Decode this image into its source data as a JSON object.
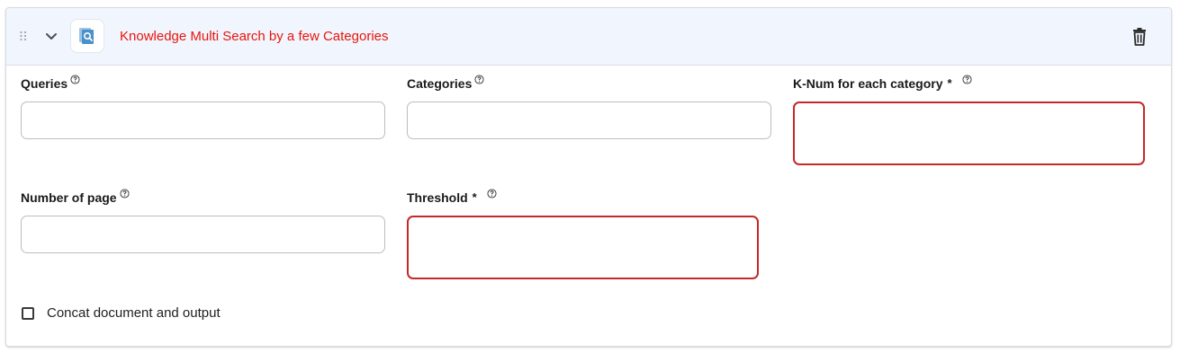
{
  "header": {
    "title": "Knowledge Multi Search by a few Categories",
    "icons": {
      "drag": "drag-handle-icon",
      "collapse": "chevron-down-icon",
      "app": "document-search-icon",
      "delete": "trash-icon"
    },
    "title_color": "#e8160c"
  },
  "fields": {
    "queries": {
      "label": "Queries",
      "value": "",
      "required": false
    },
    "categories": {
      "label": "Categories",
      "value": "",
      "required": false
    },
    "k_num": {
      "label": "K-Num for each category",
      "value": "",
      "required": true,
      "required_mark": "*"
    },
    "number_of_page": {
      "label": "Number of page",
      "value": "",
      "required": false
    },
    "threshold": {
      "label": "Threshold",
      "value": "",
      "required": true,
      "required_mark": "*"
    }
  },
  "options": {
    "concat": {
      "label": "Concat document and output",
      "checked": false
    }
  },
  "colors": {
    "error_border": "#c62828",
    "header_bg": "#f1f5fd"
  }
}
